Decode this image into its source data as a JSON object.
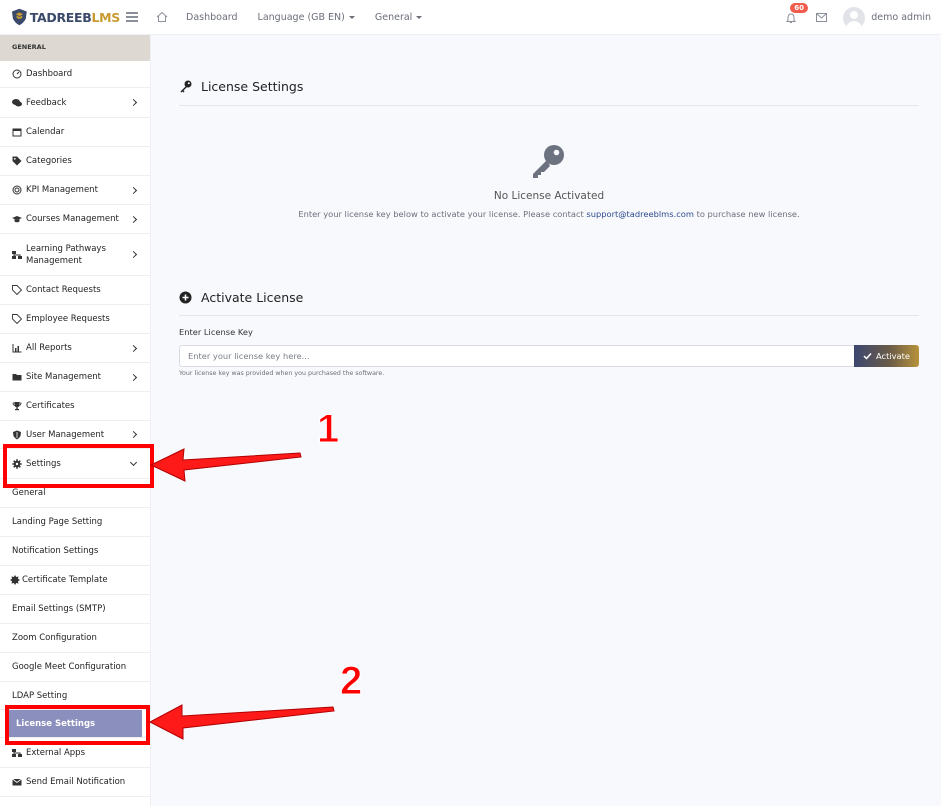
{
  "brand": {
    "part1": "TADREEB",
    "part2": "LMS"
  },
  "topnav": {
    "dashboard": "Dashboard",
    "language": "Language (GB EN)",
    "general": "General",
    "notifications_count": "60",
    "user_name": "demo admin"
  },
  "sidebar": {
    "section_header": "GENERAL",
    "items": [
      {
        "label": "Dashboard",
        "icon": "dashboard-icon"
      },
      {
        "label": "Feedback",
        "icon": "comments-icon"
      },
      {
        "label": "Calendar",
        "icon": "calendar-icon"
      },
      {
        "label": "Categories",
        "icon": "tags-icon"
      },
      {
        "label": "KPI Management",
        "icon": "target-icon"
      },
      {
        "label": "Courses Management",
        "icon": "graduation-cap-icon"
      },
      {
        "label": "Learning Pathways Management",
        "icon": "sitemap-icon"
      },
      {
        "label": "Contact Requests",
        "icon": "tag-icon"
      },
      {
        "label": "Employee Requests",
        "icon": "tag-icon"
      },
      {
        "label": "All Reports",
        "icon": "chart-icon"
      },
      {
        "label": "Site Management",
        "icon": "folder-icon"
      },
      {
        "label": "Certificates",
        "icon": "trophy-icon"
      },
      {
        "label": "User Management",
        "icon": "shield-icon"
      },
      {
        "label": "Settings",
        "icon": "gear-icon"
      }
    ],
    "settings_sub": [
      {
        "label": "General"
      },
      {
        "label": "Landing Page Setting"
      },
      {
        "label": "Notification Settings"
      },
      {
        "label": "Certificate Template"
      },
      {
        "label": "Email Settings (SMTP)"
      },
      {
        "label": "Zoom Configuration"
      },
      {
        "label": "Google Meet Configuration"
      },
      {
        "label": "LDAP Setting"
      },
      {
        "label": "License Settings"
      }
    ],
    "after": [
      {
        "label": "External Apps",
        "icon": "sitemap-icon"
      },
      {
        "label": "Send Email Notification",
        "icon": "envelope-icon"
      }
    ]
  },
  "main": {
    "license_title": "License Settings",
    "no_license_title": "No License Activated",
    "help_prefix": "Enter your license key below to activate your license. Please contact ",
    "help_email": "support@tadreeblms.com",
    "help_suffix": " to purchase new license.",
    "activate_title": "Activate License",
    "field_label": "Enter License Key",
    "input_placeholder": "Enter your license key here...",
    "activate_button": "Activate",
    "hint": "Your license key was provided when you purchased the software."
  },
  "annotations": {
    "callout_1": "1",
    "callout_2": "2"
  },
  "colors": {
    "brand_navy": "#3b4a6b",
    "brand_gold": "#c99a2e",
    "active_item": "#8b8fbd",
    "badge": "#f25c4d",
    "callout": "#ff0000"
  }
}
